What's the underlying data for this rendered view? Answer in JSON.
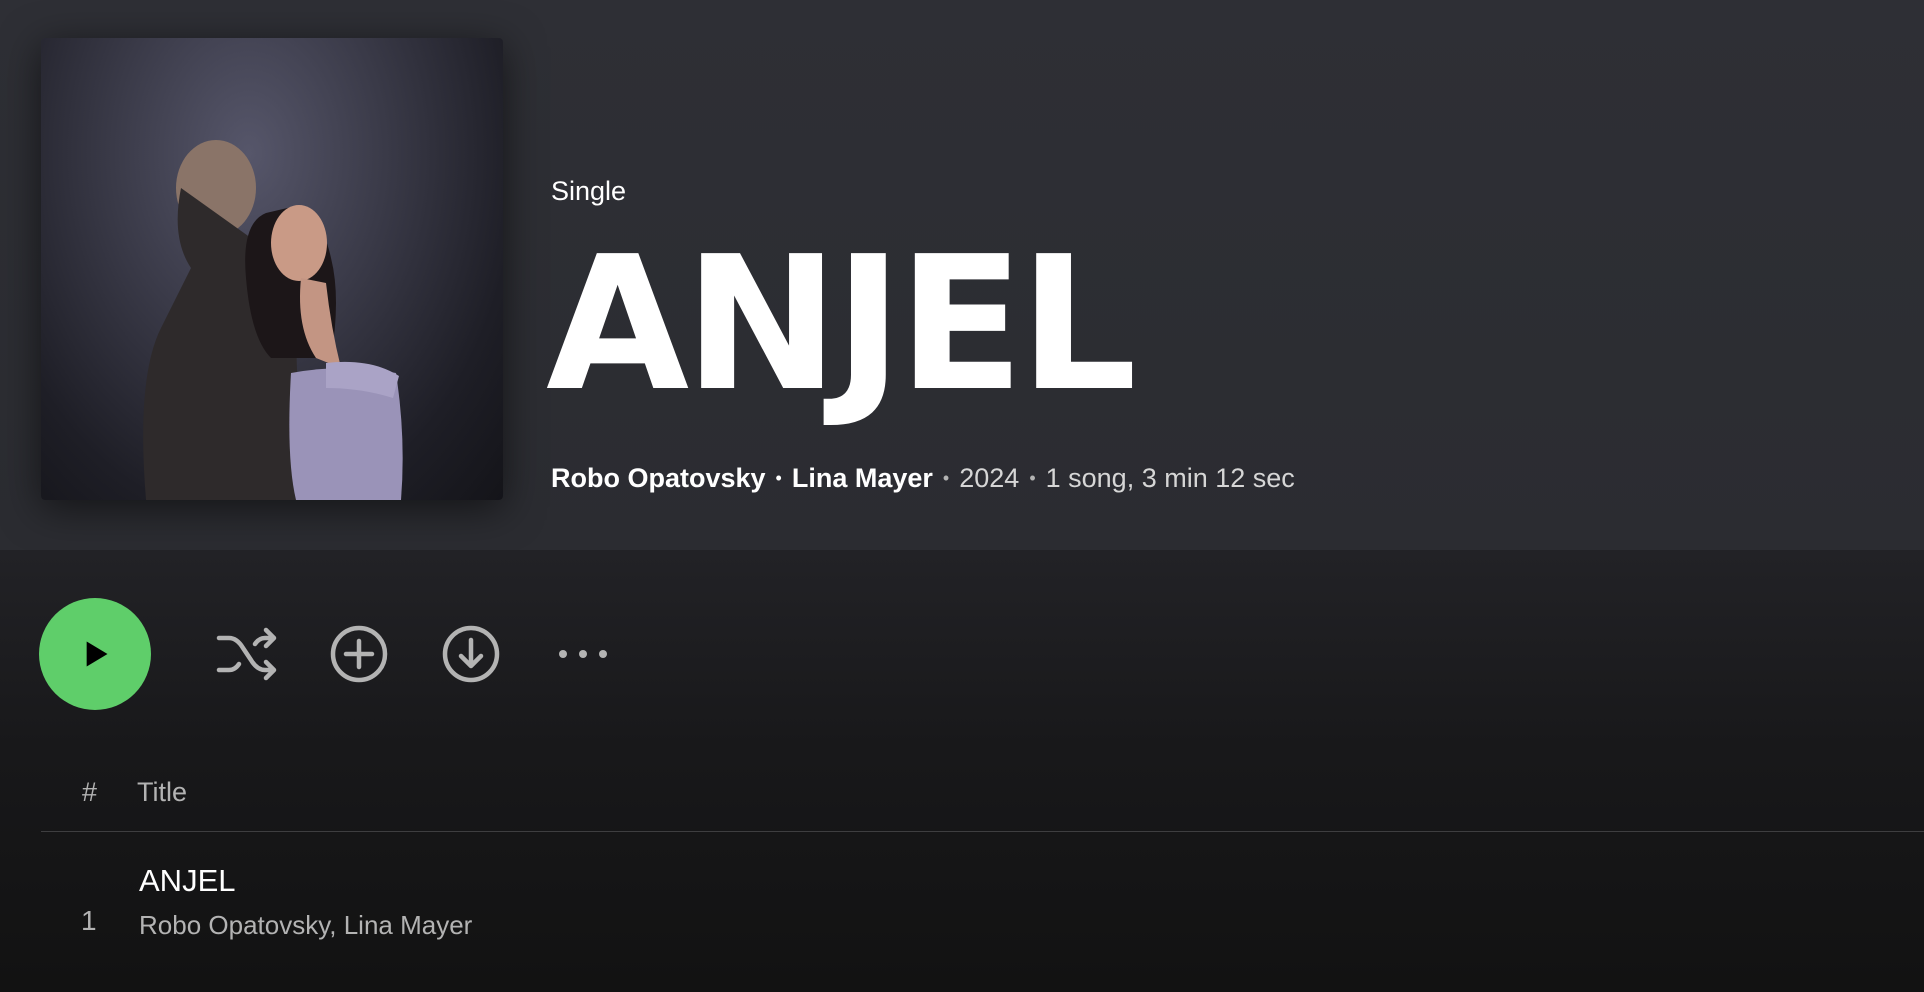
{
  "album": {
    "type_label": "Single",
    "title": "ANJEL",
    "artists": [
      "Robo Opatovsky",
      "Lina Mayer"
    ],
    "year": "2024",
    "summary": "1 song, 3 min 12 sec"
  },
  "controls": {
    "play_icon": "play-icon",
    "shuffle_icon": "shuffle-icon",
    "add_icon": "add-circle-icon",
    "download_icon": "download-circle-icon",
    "more_icon": "more-options-icon"
  },
  "table": {
    "header_num": "#",
    "header_title": "Title",
    "tracks": [
      {
        "number": "1",
        "title": "ANJEL",
        "artists": "Robo Opatovsky, Lina Mayer"
      }
    ]
  },
  "colors": {
    "accent": "#5fce6a",
    "header_bg": "#2e2f35",
    "page_bg": "#121212",
    "text_secondary": "#b3b3b3"
  }
}
